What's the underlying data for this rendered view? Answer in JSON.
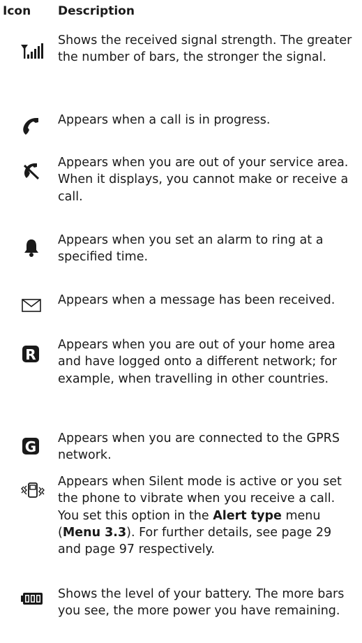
{
  "header": {
    "icon_col": "Icon",
    "desc_col": "Description"
  },
  "rows": [
    {
      "icon": "signal-strength-icon",
      "text": "Shows the received signal strength. The greater the number of bars, the stronger the signal."
    },
    {
      "icon": "call-in-progress-icon",
      "text": "Appears when a call is in progress."
    },
    {
      "icon": "no-service-icon",
      "text": "Appears when you are out of your service area. When it displays, you cannot make or receive a call."
    },
    {
      "icon": "alarm-bell-icon",
      "text": "Appears when you set an alarm to ring at a specified time."
    },
    {
      "icon": "message-envelope-icon",
      "text": "Appears when a message has been received."
    },
    {
      "icon": "roaming-icon",
      "glyph": "R",
      "text": "Appears when you are out of your home area and have logged onto a different network; for example, when travelling in other countries."
    },
    {
      "icon": "gprs-icon",
      "glyph": "G",
      "text": "Appears when you are connected to the GPRS network."
    },
    {
      "icon": "silent-vibrate-icon",
      "text_parts": [
        "Appears when Silent mode is active or you set the phone to vibrate when you receive a call. You set this option in the ",
        "Alert type",
        " menu (",
        "Menu 3.3",
        "). For further details, see page 29 and page 97 respectively."
      ]
    },
    {
      "icon": "battery-level-icon",
      "text": "Shows the level of your battery. The more bars you see, the more power you have remaining."
    }
  ]
}
